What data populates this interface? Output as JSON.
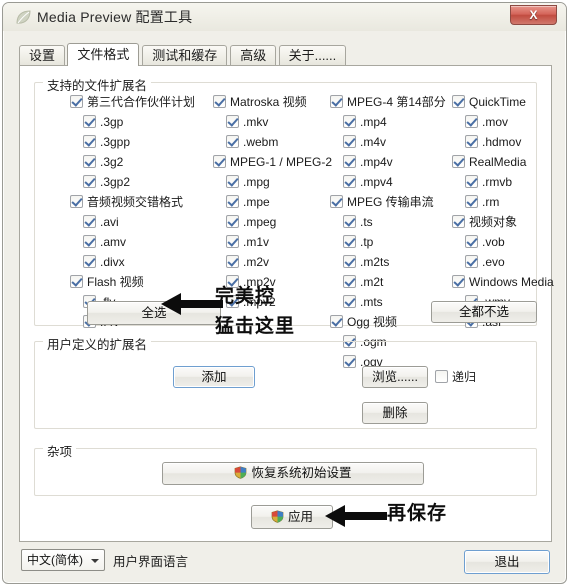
{
  "window": {
    "title": "Media Preview 配置工具",
    "app_icon": "leaf-icon",
    "close_label": "X"
  },
  "tabs": [
    {
      "label": "设置",
      "active": false
    },
    {
      "label": "文件格式",
      "active": true
    },
    {
      "label": "测试和缓存",
      "active": false
    },
    {
      "label": "高级",
      "active": false
    },
    {
      "label": "关于......",
      "active": false
    }
  ],
  "groups": {
    "extensions": {
      "legend": "支持的文件扩展名"
    },
    "user_defined": {
      "legend": "用户定义的扩展名"
    },
    "misc": {
      "legend": "杂项"
    }
  },
  "columns": [
    {
      "families": [
        {
          "label": "第三代合作伙伴计划",
          "checked": true,
          "items": [
            {
              "label": ".3gp",
              "checked": true
            },
            {
              "label": ".3gpp",
              "checked": true
            },
            {
              "label": ".3g2",
              "checked": true
            },
            {
              "label": ".3gp2",
              "checked": true
            }
          ]
        },
        {
          "label": "音频视频交错格式",
          "checked": true,
          "items": [
            {
              "label": ".avi",
              "checked": true
            },
            {
              "label": ".amv",
              "checked": true
            },
            {
              "label": ".divx",
              "checked": true
            }
          ]
        },
        {
          "label": "Flash 视频",
          "checked": true,
          "items": [
            {
              "label": ".flv",
              "checked": true
            },
            {
              "label": ".f4v",
              "checked": true
            }
          ]
        }
      ]
    },
    {
      "families": [
        {
          "label": "Matroska 视频",
          "checked": true,
          "items": [
            {
              "label": ".mkv",
              "checked": true
            },
            {
              "label": ".webm",
              "checked": true
            }
          ]
        },
        {
          "label": "MPEG-1 / MPEG-2",
          "checked": true,
          "items": [
            {
              "label": ".mpg",
              "checked": true
            },
            {
              "label": ".mpe",
              "checked": true
            },
            {
              "label": ".mpeg",
              "checked": true
            },
            {
              "label": ".m1v",
              "checked": true
            },
            {
              "label": ".m2v",
              "checked": true
            },
            {
              "label": ".mp2v",
              "checked": true
            },
            {
              "label": ".mpv2",
              "checked": true
            }
          ]
        }
      ]
    },
    {
      "families": [
        {
          "label": "MPEG-4 第14部分",
          "checked": true,
          "items": [
            {
              "label": ".mp4",
              "checked": true
            },
            {
              "label": ".m4v",
              "checked": true
            },
            {
              "label": ".mp4v",
              "checked": true
            },
            {
              "label": ".mpv4",
              "checked": true
            }
          ]
        },
        {
          "label": "MPEG 传输串流",
          "checked": true,
          "items": [
            {
              "label": ".ts",
              "checked": true
            },
            {
              "label": ".tp",
              "checked": true
            },
            {
              "label": ".m2ts",
              "checked": true
            },
            {
              "label": ".m2t",
              "checked": true
            },
            {
              "label": ".mts",
              "checked": true
            }
          ]
        },
        {
          "label": "Ogg 视频",
          "checked": true,
          "items": [
            {
              "label": ".ogm",
              "checked": true
            },
            {
              "label": ".ogv",
              "checked": true
            }
          ]
        }
      ]
    },
    {
      "families": [
        {
          "label": "QuickTime",
          "checked": true,
          "items": [
            {
              "label": ".mov",
              "checked": true
            },
            {
              "label": ".hdmov",
              "checked": true
            }
          ]
        },
        {
          "label": "RealMedia",
          "checked": true,
          "items": [
            {
              "label": ".rmvb",
              "checked": true
            },
            {
              "label": ".rm",
              "checked": true
            }
          ]
        },
        {
          "label": "视频对象",
          "checked": true,
          "items": [
            {
              "label": ".vob",
              "checked": true
            },
            {
              "label": ".evo",
              "checked": true
            }
          ]
        },
        {
          "label": "Windows Media",
          "checked": true,
          "items": [
            {
              "label": ".wmv",
              "checked": true
            },
            {
              "label": ".asf",
              "checked": true
            }
          ]
        }
      ]
    }
  ],
  "buttons": {
    "select_all": "全选",
    "select_none": "全都不选",
    "add": "添加",
    "browse": "浏览......",
    "delete": "删除",
    "restore": "恢复系统初始设置",
    "apply": "应用",
    "quit": "退出"
  },
  "recursive": {
    "label": "递归",
    "checked": false
  },
  "language": {
    "selected": "中文(简体)",
    "caption": "用户界面语言"
  },
  "annotations": [
    {
      "text": "完美控",
      "name": "annotation-perfect"
    },
    {
      "text": "猛击这里",
      "name": "annotation-click-here"
    },
    {
      "text": "再保存",
      "name": "annotation-then-save"
    }
  ],
  "colors": {
    "accent_blue": "#6f9fd0",
    "close_red": "#c14c40",
    "dialog_bg": "#f0efe9",
    "page_bg": "#ffffff",
    "check_blue": "#4a6fa5"
  }
}
